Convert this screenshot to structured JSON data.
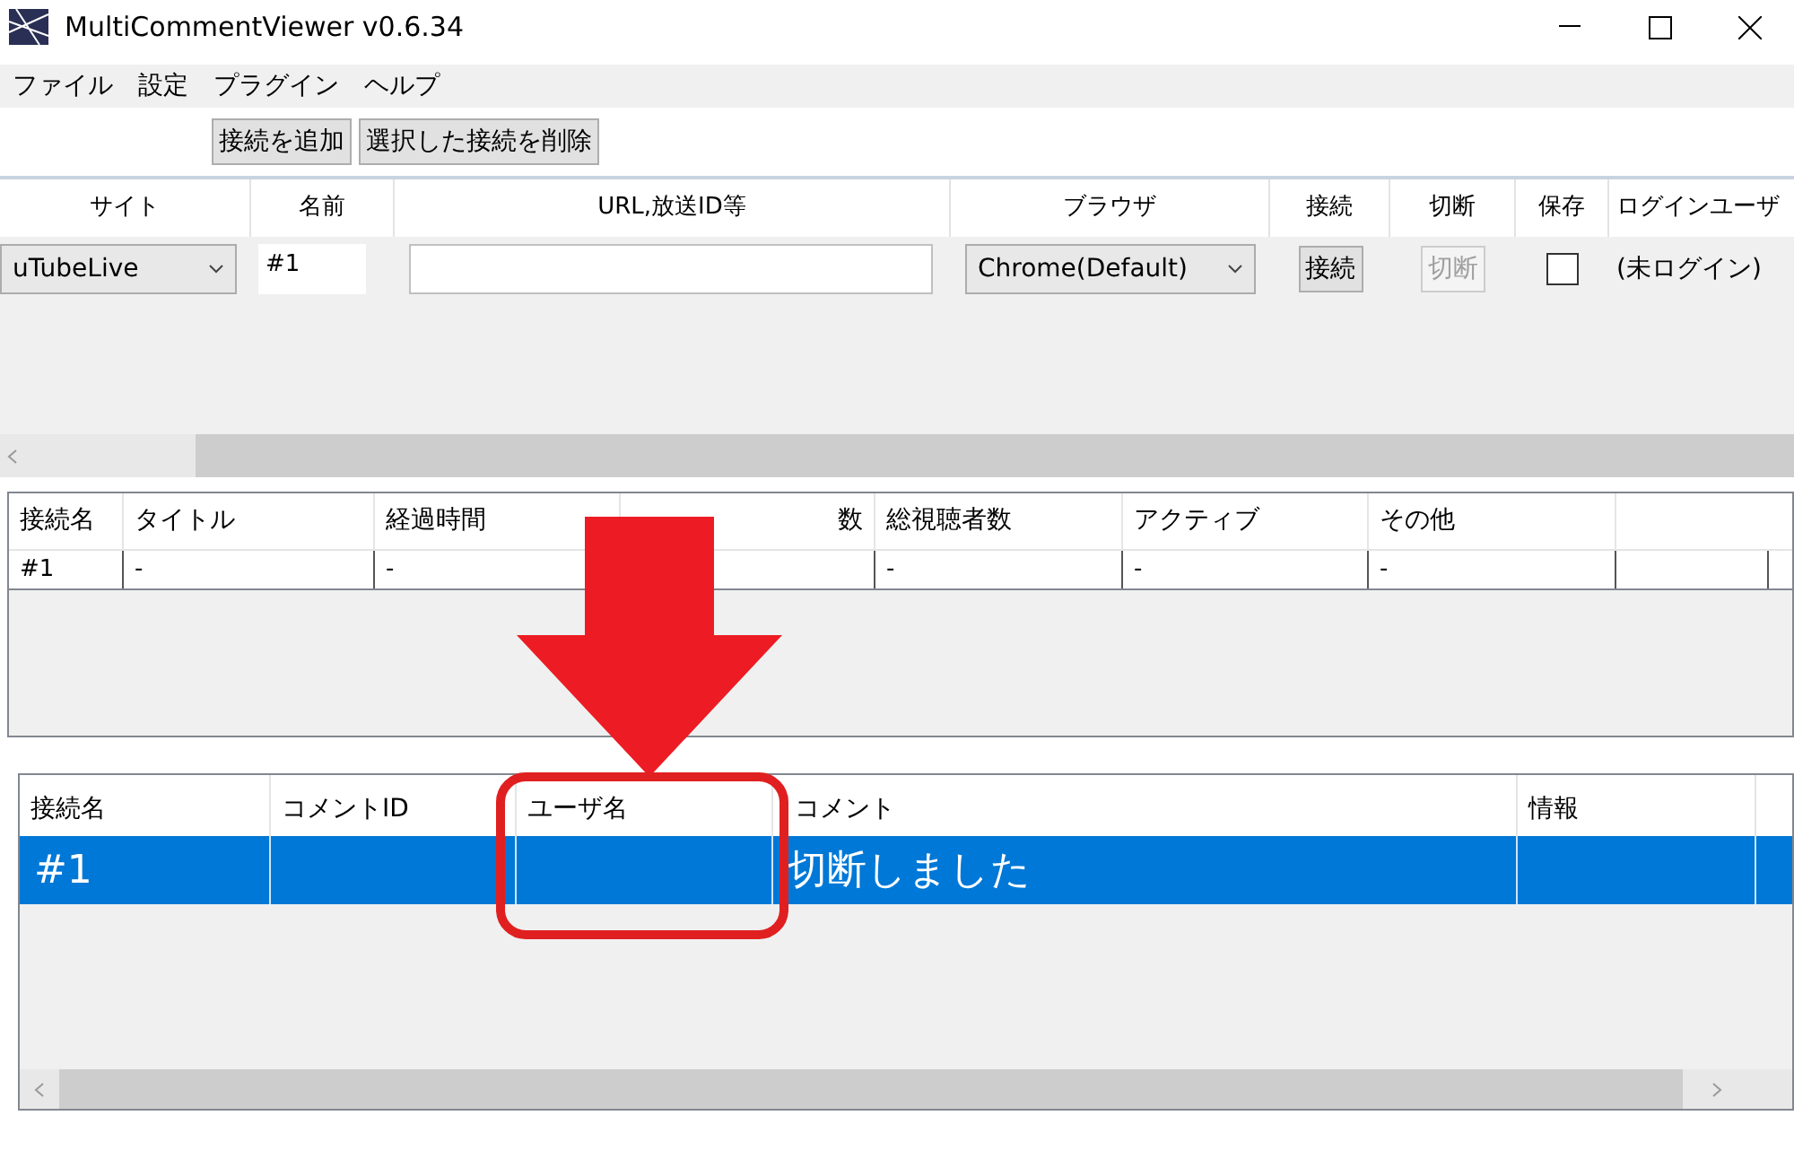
{
  "window": {
    "title": "MultiCommentViewer v0.6.34"
  },
  "menu": [
    "ファイル",
    "設定",
    "プラグイン",
    "ヘルプ"
  ],
  "toolbar": [
    "接続を追加",
    "選択した接続を削除"
  ],
  "connections": {
    "columns": [
      "サイト",
      "名前",
      "URL,放送ID等",
      "ブラウザ",
      "接続",
      "切断",
      "保存",
      "ログインユーザ"
    ],
    "rows": [
      {
        "site": "uTubeLive",
        "name": "#1",
        "browser": "Chrome(Default)",
        "connect": {
          "label": "接続",
          "disabled": false
        },
        "disconnect": {
          "label": "切断",
          "disabled": true
        },
        "save": false,
        "login_user": "(未ログイン)"
      }
    ]
  },
  "status_table": {
    "columns": [
      "接続名",
      "タイトル",
      "経過時間",
      "数",
      "総視聴者数",
      "アクティブ",
      "その他"
    ],
    "rows": [
      {
        "cells": [
          {
            "text": "#1"
          },
          {
            "text": "-"
          },
          {
            "text": "-"
          },
          {},
          {
            "text": "-"
          },
          {
            "text": "-"
          },
          {
            "text": "-"
          }
        ]
      }
    ]
  },
  "comments": {
    "columns": [
      "接続名",
      "コメントID",
      "ユーザ名",
      "コメント",
      "情報"
    ],
    "rows": [
      {
        "selected": true,
        "cells": [
          "#1",
          "",
          "",
          "切断しました",
          ""
        ]
      }
    ]
  },
  "annotations": [
    {
      "kind": "arrow",
      "color": "#ed1c24"
    },
    {
      "kind": "frame",
      "color": "#e02020"
    }
  ]
}
